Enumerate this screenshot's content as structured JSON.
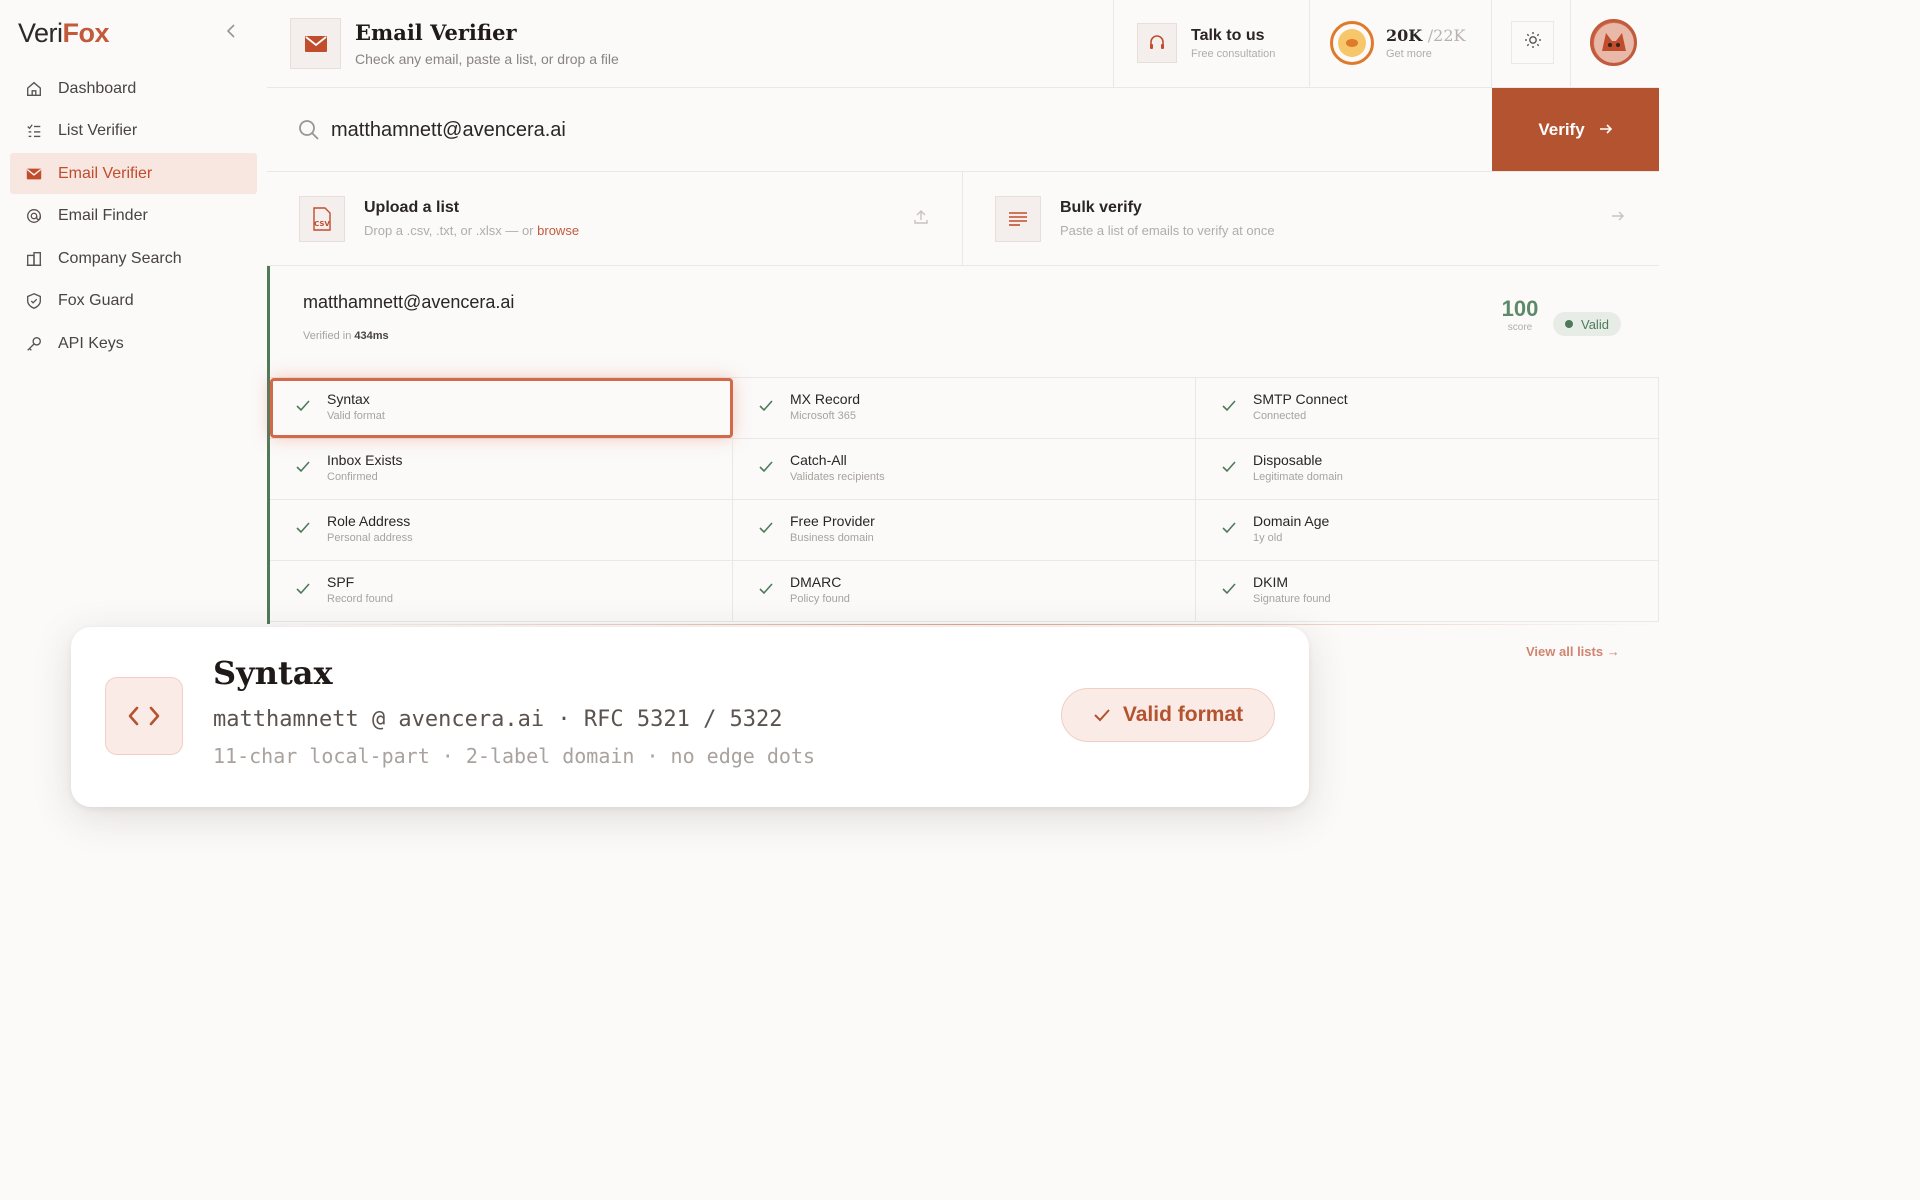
{
  "brand": {
    "part1": "Veri",
    "part2": "Fox"
  },
  "sidebar": {
    "items": [
      {
        "label": "Dashboard",
        "icon": "home-icon",
        "active": false
      },
      {
        "label": "List Verifier",
        "icon": "list-icon",
        "active": false
      },
      {
        "label": "Email Verifier",
        "icon": "mail-icon",
        "active": true
      },
      {
        "label": "Email Finder",
        "icon": "at-sign-icon",
        "active": false
      },
      {
        "label": "Company Search",
        "icon": "building-icon",
        "active": false
      },
      {
        "label": "Fox Guard",
        "icon": "shield-icon",
        "active": false
      },
      {
        "label": "API Keys",
        "icon": "key-icon",
        "active": false
      }
    ]
  },
  "header": {
    "title": "Email Verifier",
    "subtitle": "Check any email, paste a list, or drop a file",
    "talk_title": "Talk to us",
    "talk_sub": "Free consultation",
    "credits_used": "20K",
    "credits_total": "/22K",
    "credits_sub": "Get more"
  },
  "search": {
    "value": "matthamnett@avencera.ai",
    "button_label": "Verify"
  },
  "tools": {
    "upload_title": "Upload a list",
    "upload_sub": "Drop a .csv, .txt, or .xlsx — or",
    "upload_link": "browse",
    "upload_icon_text": "CSV",
    "bulk_title": "Bulk verify",
    "bulk_sub": "Paste a list of emails to verify at once"
  },
  "result": {
    "email": "matthamnett@avencera.ai",
    "time_prefix": "Verified in",
    "time_value": "434ms",
    "score": "100",
    "score_label": "score",
    "status": "Valid",
    "checks": [
      [
        {
          "label": "Syntax",
          "sub": "Valid format"
        },
        {
          "label": "MX Record",
          "sub": "Microsoft 365"
        },
        {
          "label": "SMTP Connect",
          "sub": "Connected"
        }
      ],
      [
        {
          "label": "Inbox Exists",
          "sub": "Confirmed"
        },
        {
          "label": "Catch-All",
          "sub": "Validates recipients"
        },
        {
          "label": "Disposable",
          "sub": "Legitimate domain"
        }
      ],
      [
        {
          "label": "Role Address",
          "sub": "Personal address"
        },
        {
          "label": "Free Provider",
          "sub": "Business domain"
        },
        {
          "label": "Domain Age",
          "sub": "1y old"
        }
      ],
      [
        {
          "label": "SPF",
          "sub": "Record found"
        },
        {
          "label": "DMARC",
          "sub": "Policy found"
        },
        {
          "label": "DKIM",
          "sub": "Signature found"
        }
      ]
    ]
  },
  "view_all": "View all lists",
  "card": {
    "title": "Syntax",
    "line1": "matthamnett @ avencera.ai · RFC 5321 / 5322",
    "line2": "11-char local-part · 2-label domain · no edge dots",
    "badge": "Valid format"
  },
  "colors": {
    "accent": "#b4532f",
    "valid_green": "#4e7a5a",
    "active_nav_bg": "#f8e6e1"
  }
}
